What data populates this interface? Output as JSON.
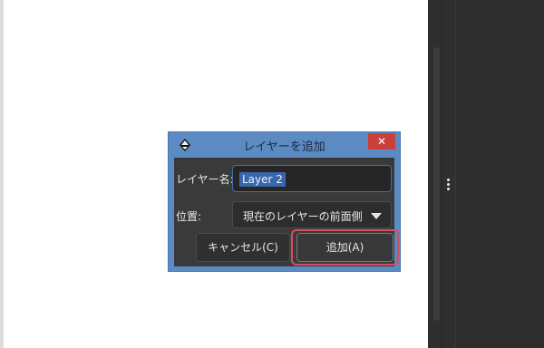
{
  "dialog": {
    "title": "レイヤーを追加",
    "close_glyph": "✕",
    "app_icon": "inkscape-icon",
    "name_label": "レイヤー名:",
    "name_value": "Layer 2",
    "position_label": "位置:",
    "position_value": "現在のレイヤーの前面側",
    "cancel_label": "キャンセル(C)",
    "add_label": "追加(A)"
  },
  "colors": {
    "titlebar": "#5c8bc4",
    "close_button": "#c9403a",
    "dialog_body": "#3a3a3a",
    "selection": "#3a66b0",
    "highlight_ring": "#d84d5a"
  }
}
